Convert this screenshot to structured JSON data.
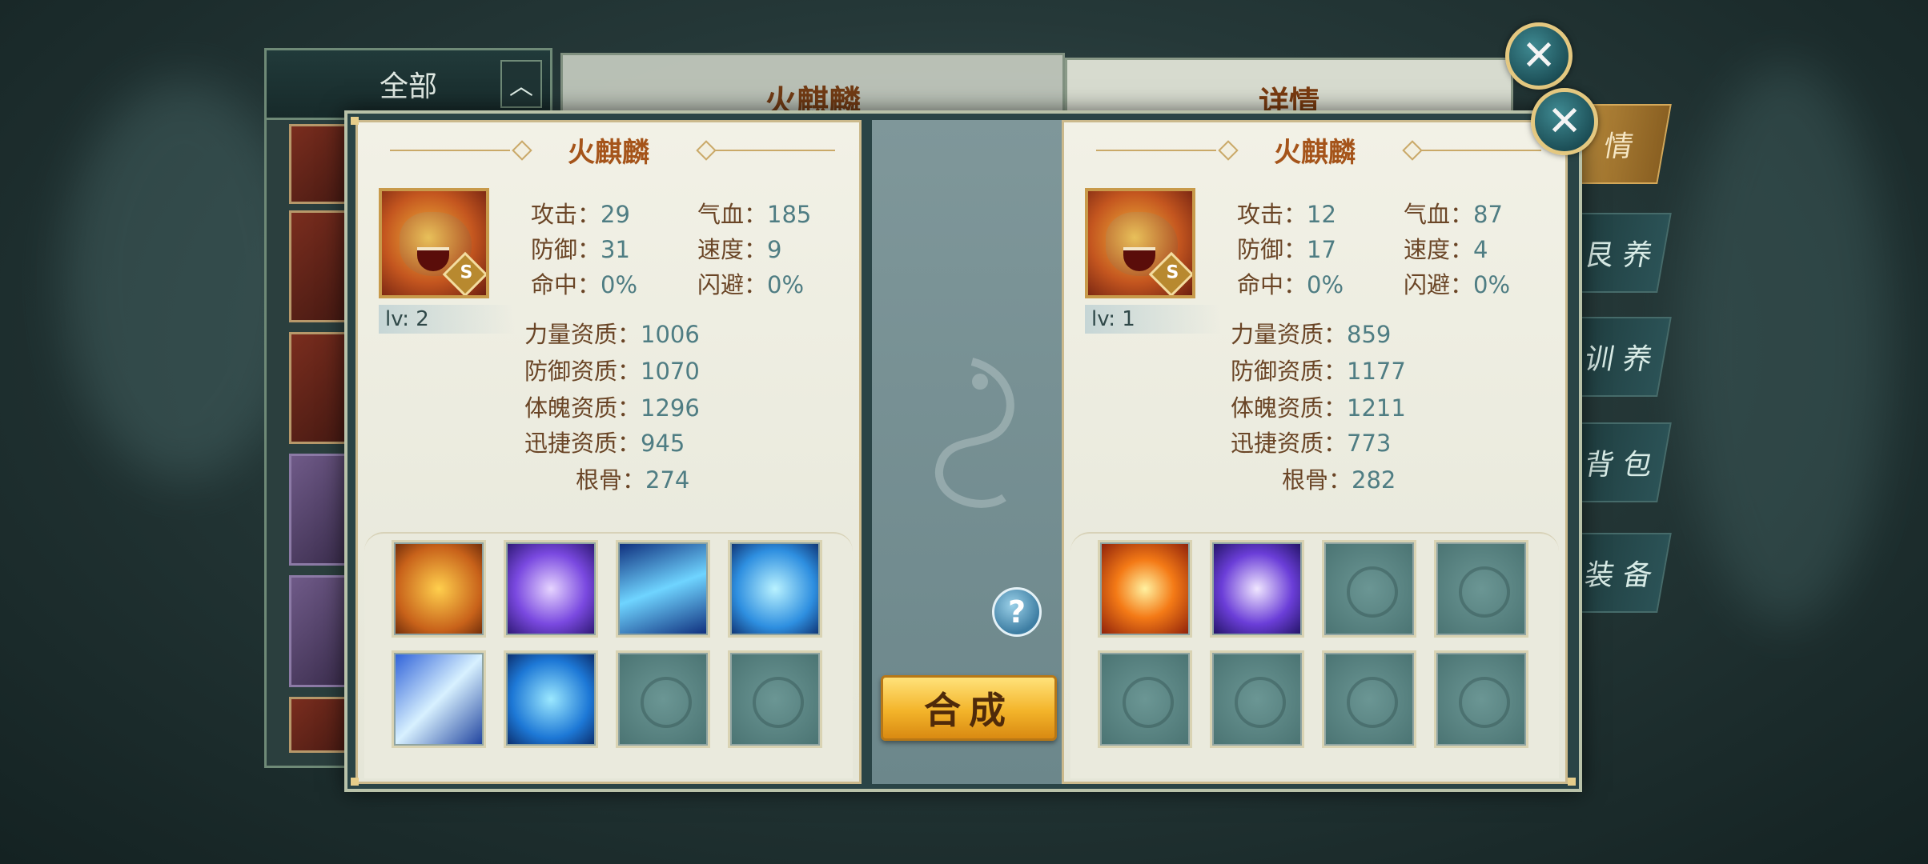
{
  "background": {
    "list_header": "全部",
    "center_title": "火麒麟",
    "right_title": "详情",
    "tabs": [
      "情",
      "艮 养",
      "训 养",
      "背 包",
      "装 备"
    ]
  },
  "compose_button": "合成",
  "help_button": "?",
  "left_pet": {
    "name": "火麒麟",
    "grade": "S",
    "level": "lv: 2",
    "stats": [
      {
        "label": "攻击：",
        "value": "29"
      },
      {
        "label": "气血：",
        "value": "185"
      },
      {
        "label": "防御：",
        "value": "31"
      },
      {
        "label": "速度：",
        "value": "9"
      },
      {
        "label": "命中：",
        "value": "0%"
      },
      {
        "label": "闪避：",
        "value": "0%"
      }
    ],
    "aptitudes": [
      {
        "label": "力量资质：",
        "value": "1006"
      },
      {
        "label": "防御资质：",
        "value": "1070"
      },
      {
        "label": "体魄资质：",
        "value": "1296"
      },
      {
        "label": "迅捷资质：",
        "value": "945"
      },
      {
        "label": "根骨：",
        "value": "274"
      }
    ],
    "skills": [
      "lion-roar-skill-icon",
      "purple-vortex-skill-icon",
      "blue-slash-skill-icon",
      "ice-shield-skill-icon",
      "lightning-skill-icon",
      "blue-beast-skill-icon",
      "empty",
      "empty"
    ]
  },
  "right_pet": {
    "name": "火麒麟",
    "grade": "S",
    "level": "lv: 1",
    "stats": [
      {
        "label": "攻击：",
        "value": "12"
      },
      {
        "label": "气血：",
        "value": "87"
      },
      {
        "label": "防御：",
        "value": "17"
      },
      {
        "label": "速度：",
        "value": "4"
      },
      {
        "label": "命中：",
        "value": "0%"
      },
      {
        "label": "闪避：",
        "value": "0%"
      }
    ],
    "aptitudes": [
      {
        "label": "力量资质：",
        "value": "859"
      },
      {
        "label": "防御资质：",
        "value": "1177"
      },
      {
        "label": "体魄资质：",
        "value": "1211"
      },
      {
        "label": "迅捷资质：",
        "value": "773"
      },
      {
        "label": "根骨：",
        "value": "282"
      }
    ],
    "skills": [
      "fire-burst-skill-icon",
      "purple-orb-skill-icon",
      "empty",
      "empty",
      "empty",
      "empty",
      "empty",
      "empty"
    ]
  },
  "colors": {
    "label": "#6a4526",
    "value": "#4f7d83",
    "name": "#a5541a",
    "compose_gold": "#f3b42a"
  }
}
